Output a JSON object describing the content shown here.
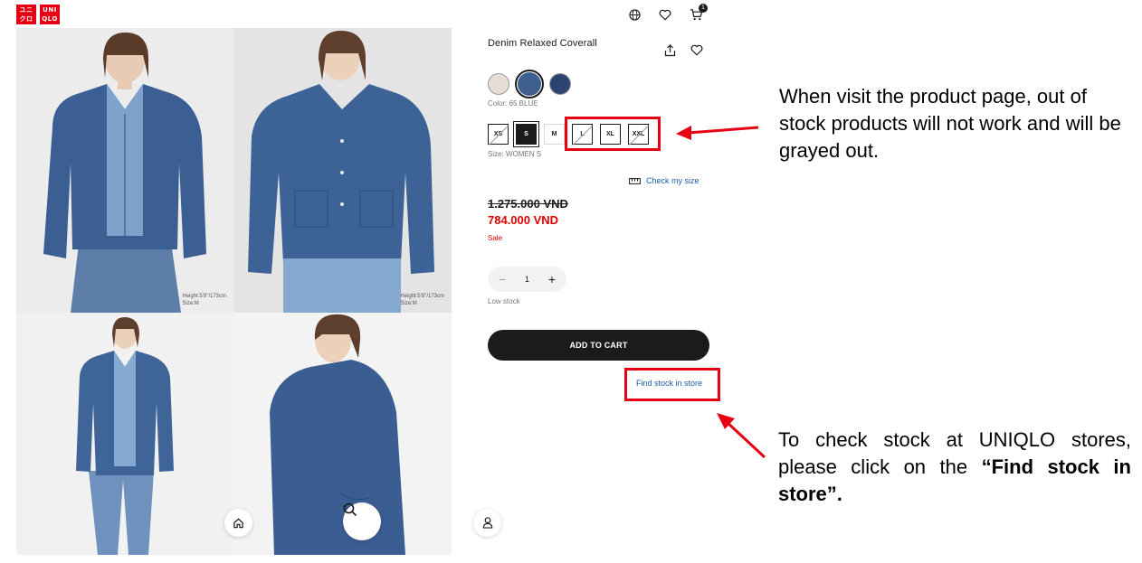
{
  "header": {
    "logo_top": "ユニ",
    "logo_bottom": "クロ",
    "logo_top_latin": "UNI",
    "logo_bottom_latin": "QLO",
    "cart_count": "1",
    "icons": [
      "globe-icon",
      "heart-icon",
      "cart-icon"
    ]
  },
  "gallery": {
    "photo1_meta_height": "Height:5'8\"/173cm",
    "photo1_meta_size": "Size:M",
    "photo2_meta_height": "Height:5'8\"/173cm",
    "photo2_meta_size": "Size:M"
  },
  "product": {
    "title": "Denim Relaxed Coverall",
    "color_label": "Color: 65 BLUE",
    "swatches": [
      {
        "name": "natural",
        "color": "#e6ded5"
      },
      {
        "name": "blue",
        "color": "#3f5f8f"
      },
      {
        "name": "navy",
        "color": "#2d4470"
      }
    ],
    "sizes": [
      {
        "label": "XS",
        "state": "out"
      },
      {
        "label": "S",
        "state": "selected"
      },
      {
        "label": "M",
        "state": "available"
      },
      {
        "label": "L",
        "state": "out"
      },
      {
        "label": "XL",
        "state": "available"
      },
      {
        "label": "XXL",
        "state": "out"
      }
    ],
    "size_label": "Size: WOMEN S",
    "check_size": "Check my size",
    "old_price": "1.275.000 VND",
    "new_price": "784.000 VND",
    "sale": "Sale",
    "quantity": "1",
    "qty_minus": "−",
    "qty_plus": "+",
    "low_stock": "Low stock",
    "add_to_cart": "ADD TO CART",
    "find_stock": "Find stock in store"
  },
  "annotations": {
    "sizes_note": "When visit the product page, out of stock products will not work and will be grayed out.",
    "stock_note_plain": "To check stock at UNIQLO stores, please click on the ",
    "stock_note_bold": "“Find stock in store”."
  },
  "colors": {
    "brand_red": "#e60012",
    "sale_red": "#e00000",
    "link_blue": "#1c5ea8",
    "dark": "#1b1b1b"
  }
}
